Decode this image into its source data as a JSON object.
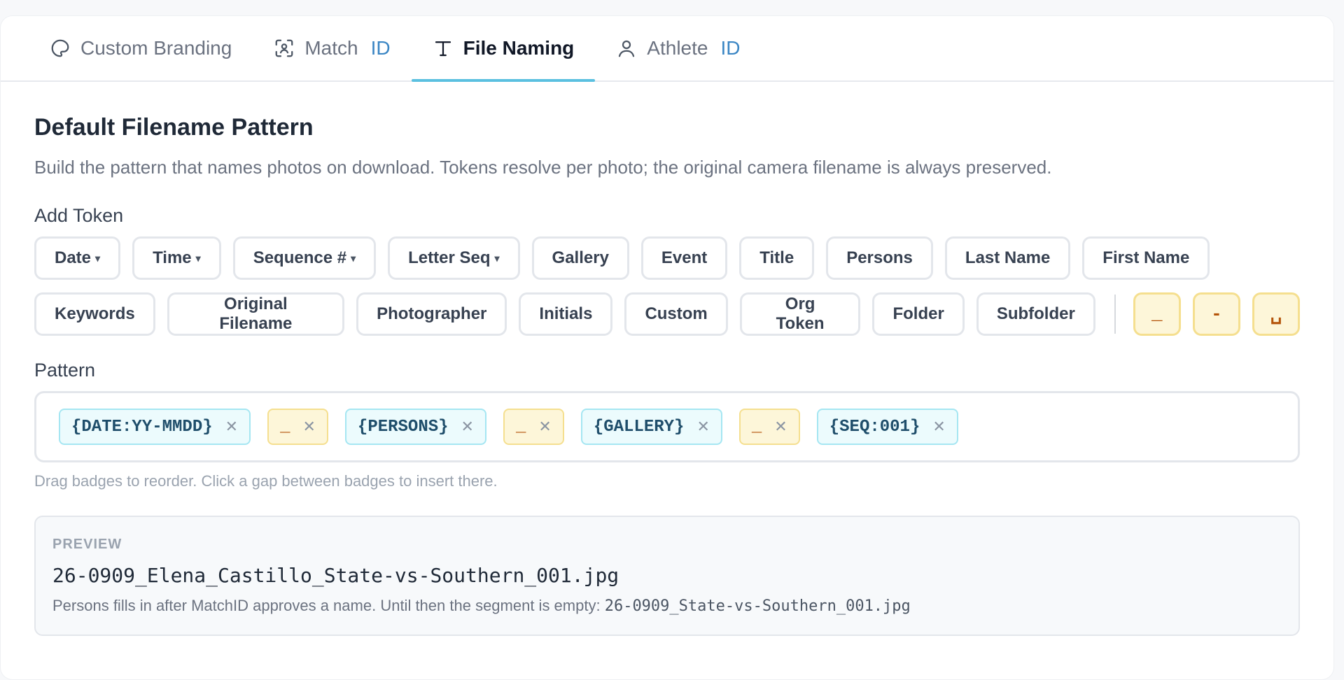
{
  "tabs": [
    {
      "label": "Custom Branding",
      "suffix": "",
      "icon": "palette-icon",
      "active": false
    },
    {
      "label": "Match",
      "suffix": "ID",
      "icon": "face-scan-icon",
      "active": false
    },
    {
      "label": "File Naming",
      "suffix": "",
      "icon": "text-icon",
      "active": true
    },
    {
      "label": "Athlete",
      "suffix": "ID",
      "icon": "user-icon",
      "active": false
    }
  ],
  "section": {
    "title": "Default Filename Pattern",
    "description": "Build the pattern that names photos on download. Tokens resolve per photo; the original camera filename is always preserved."
  },
  "add_token": {
    "label": "Add Token",
    "row1": [
      {
        "label": "Date",
        "caret": "▾"
      },
      {
        "label": "Time",
        "caret": "▾"
      },
      {
        "label": "Sequence #",
        "caret": "▾"
      },
      {
        "label": "Letter Seq",
        "caret": "▾"
      },
      {
        "label": "Gallery"
      },
      {
        "label": "Event"
      },
      {
        "label": "Title"
      },
      {
        "label": "Persons"
      },
      {
        "label": "Last Name"
      },
      {
        "label": "First Name"
      }
    ],
    "row2": [
      {
        "label": "Keywords"
      },
      {
        "label": "Original Filename"
      },
      {
        "label": "Photographer"
      },
      {
        "label": "Initials"
      },
      {
        "label": "Custom"
      },
      {
        "label": "Org Token"
      },
      {
        "label": "Folder"
      },
      {
        "label": "Subfolder"
      }
    ],
    "separators": [
      "_",
      "-",
      "␣"
    ]
  },
  "pattern": {
    "label": "Pattern",
    "badges": [
      {
        "text": "{DATE:YY-MMDD}",
        "kind": "token"
      },
      {
        "text": "_",
        "kind": "sep"
      },
      {
        "text": "{PERSONS}",
        "kind": "token"
      },
      {
        "text": "_",
        "kind": "sep"
      },
      {
        "text": "{GALLERY}",
        "kind": "token"
      },
      {
        "text": "_",
        "kind": "sep"
      },
      {
        "text": "{SEQ:001}",
        "kind": "token"
      }
    ],
    "remove_glyph": "✕",
    "hint": "Drag badges to reorder. Click a gap between badges to insert there."
  },
  "preview": {
    "label": "PREVIEW",
    "filename": "26-0909_Elena_Castillo_State-vs-Southern_001.jpg",
    "note": "Persons fills in after MatchID approves a name. Until then the segment is empty: ",
    "note_example": "26-0909_State-vs-Southern_001.jpg"
  }
}
